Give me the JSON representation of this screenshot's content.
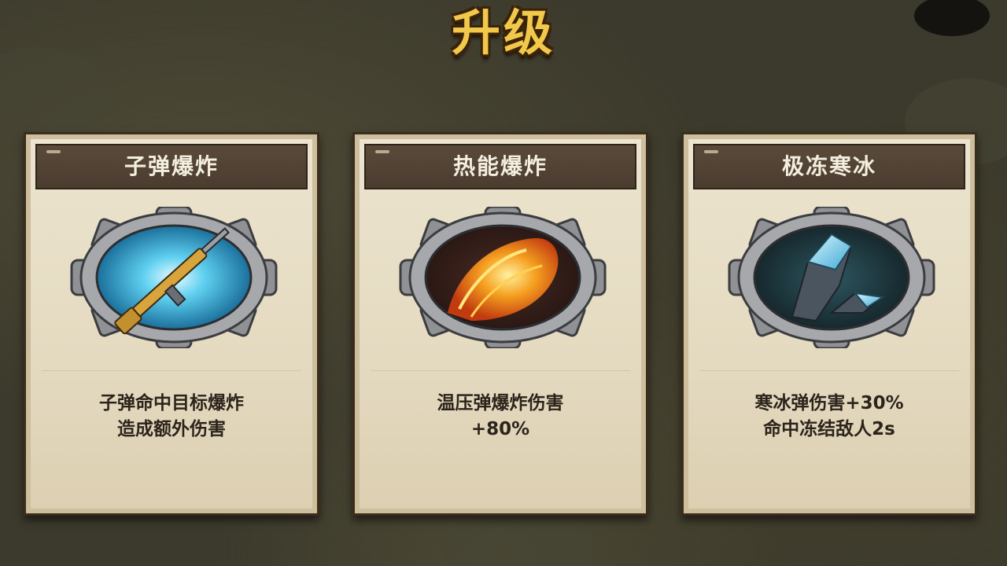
{
  "title": "升级",
  "cards": [
    {
      "name": "子弹爆炸",
      "icon": "rifle-icon",
      "description": [
        "子弹命中目标爆炸",
        "造成额外伤害"
      ]
    },
    {
      "name": "热能爆炸",
      "icon": "fire-burst-icon",
      "description": [
        "温压弹爆炸伤害",
        "+80%"
      ]
    },
    {
      "name": "极冻寒冰",
      "icon": "ice-crystal-icon",
      "description": [
        "寒冰弹伤害+30%",
        "命中冻结敌人2s"
      ]
    }
  ],
  "colors": {
    "title": "#f2c84b",
    "card_paper": "#e4dac0",
    "card_header": "#4a3c2f"
  }
}
